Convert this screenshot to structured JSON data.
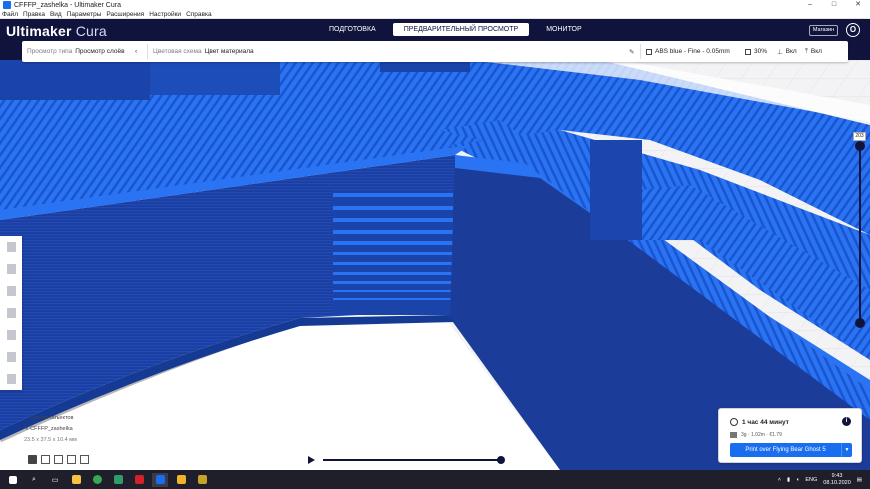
{
  "window": {
    "title": "CFFFP_zashelka - Ultimaker Cura",
    "controls": [
      "–",
      "□",
      "✕"
    ]
  },
  "menu": [
    "Файл",
    "Правка",
    "Вид",
    "Параметры",
    "Расширения",
    "Настройки",
    "Справка"
  ],
  "header": {
    "logo_brand": "Ultimaker",
    "logo_product": " Cura",
    "stages": [
      "ПОДГОТОВКА",
      "ПРЕДВАРИТЕЛЬНЫЙ ПРОСМОТР",
      "МОНИТОР"
    ],
    "active_stage": 1,
    "marketplace_label": "Магазин",
    "user_initial": "O"
  },
  "toolbar": {
    "view_type_label": "Просмотр типа",
    "view_type_value": "Просмотр слоёв",
    "color_scheme_label": "Цветовая схема",
    "color_scheme_value": "Цвет материала",
    "profile": "ABS blue - Fine - 0.05mm",
    "infill": "30%",
    "support": "Вкл",
    "adhesion": "Вкл"
  },
  "layer_slider": {
    "value": "203",
    "upper_fraction": 0.0,
    "lower_fraction": 1.0
  },
  "object_panel": {
    "list_label": "Список объектов",
    "object_name": "CFFFP_zashelka",
    "dimensions": "23.5 x 37.5 x 10.4 мм"
  },
  "simulation": {
    "progress": 1.0
  },
  "job": {
    "time": "1 час 44 минут",
    "material": "3g · 1.02m · €1.79",
    "print_button": "Print over Flying Bear Ghost 5",
    "info_icon": "i"
  },
  "taskbar": {
    "icons": [
      "windows-start-icon",
      "search-icon",
      "task-view-icon",
      "file-explorer-icon",
      "chrome-icon",
      "app-3d-icon",
      "acrobat-icon",
      "cura-icon",
      "folder-icon",
      "app-icon"
    ],
    "lang": "ENG",
    "time": "9:43",
    "date": "08.10.2020"
  },
  "colors": {
    "header_bg": "#10143d",
    "accent_blue": "#196ef0",
    "model_blue": "#1e5fdc",
    "model_dark": "#0e2f78"
  }
}
